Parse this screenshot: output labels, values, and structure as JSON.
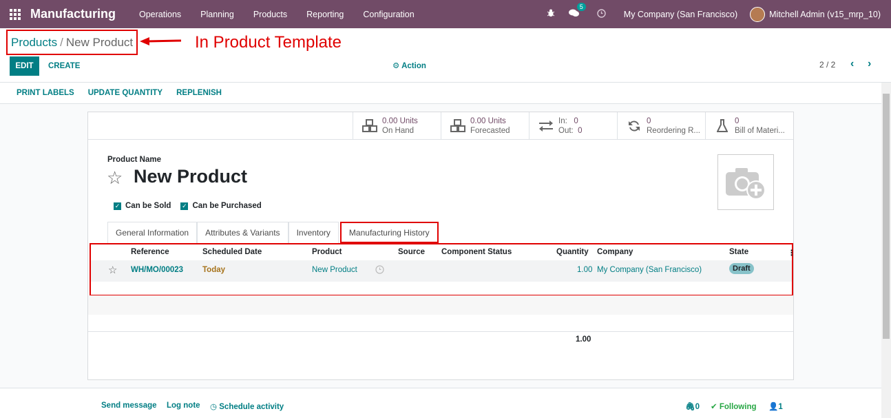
{
  "navbar": {
    "app_name": "Manufacturing",
    "menu": [
      "Operations",
      "Planning",
      "Products",
      "Reporting",
      "Configuration"
    ],
    "chat_count": "5",
    "company": "My Company (San Francisco)",
    "user": "Mitchell Admin (v15_mrp_10)"
  },
  "breadcrumb": {
    "parent": "Products",
    "separator": "/",
    "current": "New Product"
  },
  "annotation": "In Product Template",
  "control": {
    "edit": "EDIT",
    "create": "CREATE",
    "action": "Action",
    "pager": "2 / 2"
  },
  "statusbar": [
    "PRINT LABELS",
    "UPDATE QUANTITY",
    "REPLENISH"
  ],
  "smart_buttons": [
    {
      "value": "0.00 Units",
      "label": "On Hand"
    },
    {
      "value": "0.00 Units",
      "label": "Forecasted"
    },
    {
      "in_label": "In:",
      "in_value": "0",
      "out_label": "Out:",
      "out_value": "0"
    },
    {
      "value": "0",
      "label": "Reordering R..."
    },
    {
      "value": "0",
      "label": "Bill of Materi..."
    }
  ],
  "product": {
    "name_label": "Product Name",
    "name": "New Product",
    "can_be_sold": "Can be Sold",
    "can_be_purchased": "Can be Purchased"
  },
  "tabs": [
    "General Information",
    "Attributes & Variants",
    "Inventory",
    "Manufacturing History"
  ],
  "table": {
    "headers": [
      "Reference",
      "Scheduled Date",
      "Product",
      "Source",
      "Component Status",
      "Quantity",
      "Company",
      "State"
    ],
    "rows": [
      {
        "reference": "WH/MO/00023",
        "date": "Today",
        "product": "New Product",
        "source": "",
        "component_status": "",
        "quantity": "1.00",
        "company": "My Company (San Francisco)",
        "state": "Draft"
      }
    ],
    "total": "1.00"
  },
  "chatter": {
    "send_message": "Send message",
    "log_note": "Log note",
    "schedule_activity": "Schedule activity",
    "attachments": "0",
    "following": "Following",
    "followers": "1"
  },
  "colors": {
    "brand": "#714b67",
    "accent": "#017e84",
    "highlight": "#e00000"
  }
}
